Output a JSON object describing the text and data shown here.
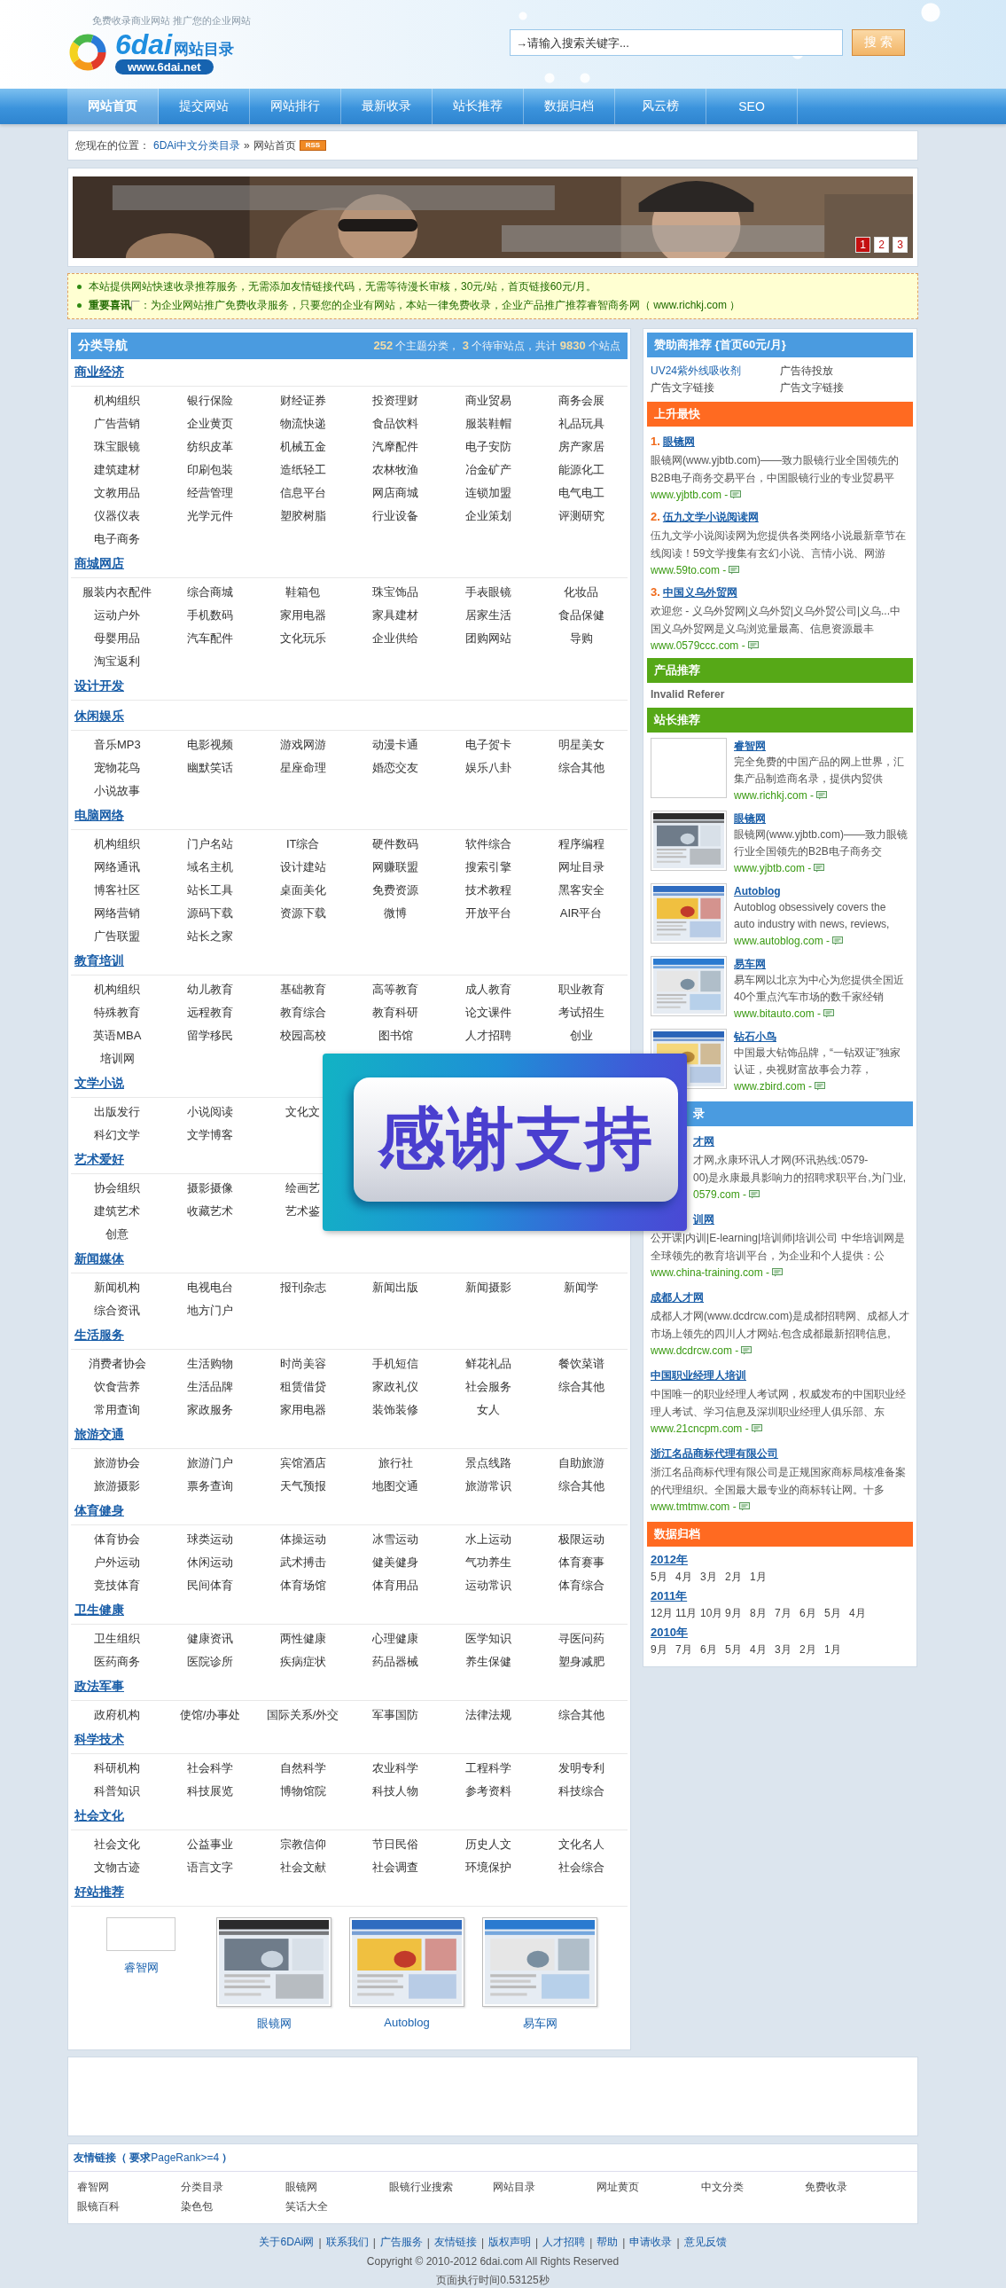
{
  "header": {
    "tagline": "免费收录商业网站 推广您的企业网站",
    "logo_mark": "6dai",
    "logo_title": "网站目录",
    "logo_url": "www.6dai.net",
    "search": {
      "placeholder": "→请输入搜索关键字..."
    },
    "search_button": "搜 索"
  },
  "nav": [
    {
      "label": "网站首页",
      "selected": true
    },
    {
      "label": "提交网站",
      "selected": false
    },
    {
      "label": "网站排行",
      "selected": false
    },
    {
      "label": "最新收录",
      "selected": false
    },
    {
      "label": "站长推荐",
      "selected": false
    },
    {
      "label": "数据归档",
      "selected": false
    },
    {
      "label": "风云榜",
      "selected": false
    },
    {
      "label": "SEO",
      "selected": false
    }
  ],
  "breadcrumb": {
    "prefix": "您现在的位置：",
    "link": "6DAi中文分类目录",
    "separator": "»",
    "current": "网站首页",
    "badge": "RSS"
  },
  "banner": {
    "kind": "picture",
    "pages": [
      {
        "label": "1",
        "selected": true
      },
      {
        "label": "2",
        "selected": false
      },
      {
        "label": "3",
        "selected": false
      }
    ]
  },
  "notices": [
    {
      "kind": "plain",
      "text": "本站提供网站快速收录推荐服务，无需添加友情链接代码，无需等待漫长审核，30元/站，首页链接60元/月。"
    },
    {
      "kind": "announcement",
      "lead": "重要喜讯",
      "text": "：为企业网站推广免费收录服务，只要您的企业有网站，本站一律免费收录，企业产品推广推荐睿智商务网（ www.richkj.com ）"
    }
  ],
  "directory": {
    "title": "分类导航",
    "stats": "**252** 个主题分类， **3** 个待审站点，共计 **9830** 个站点",
    "categories": [
      {
        "name": "商业经济",
        "rows": [
          [
            "机构组织",
            "银行保险",
            "财经证券",
            "投资理财",
            "商业贸易",
            "商务会展"
          ],
          [
            "广告营销",
            "企业黄页",
            "物流快递",
            "食品饮料",
            "服装鞋帽",
            "礼品玩具"
          ],
          [
            "珠宝眼镜",
            "纺织皮革",
            "机械五金",
            "汽摩配件",
            "电子安防",
            "房产家居"
          ],
          [
            "建筑建材",
            "印刷包装",
            "造纸轻工",
            "农林牧渔",
            "冶金矿产",
            "能源化工"
          ],
          [
            "文教用品",
            "经营管理",
            "信息平台",
            "网店商城",
            "连锁加盟",
            "电气电工"
          ],
          [
            "仪器仪表",
            "光学元件",
            "塑胶树脂",
            "行业设备",
            "企业策划",
            "评测研究"
          ],
          [
            "电子商务"
          ]
        ]
      },
      {
        "name": "商城网店",
        "rows": [
          [
            "服装内衣配件",
            "综合商城",
            "鞋箱包",
            "珠宝饰品",
            "手表眼镜",
            "化妆品"
          ],
          [
            "运动户外",
            "手机数码",
            "家用电器",
            "家具建材",
            "居家生活",
            "食品保健"
          ],
          [
            "母婴用品",
            "汽车配件",
            "文化玩乐",
            "企业供给",
            "团购网站",
            "导购"
          ],
          [
            "淘宝返利"
          ]
        ]
      },
      {
        "name": "设计开发"
      },
      {
        "name": "休闲娱乐",
        "rows": [
          [
            "音乐MP3",
            "电影视频",
            "游戏网游",
            "动漫卡通",
            "电子贺卡",
            "明星美女"
          ],
          [
            "宠物花鸟",
            "幽默笑话",
            "星座命理",
            "婚恋交友",
            "娱乐八卦",
            "综合其他"
          ],
          [
            "小说故事"
          ]
        ]
      },
      {
        "name": "电脑网络",
        "rows": [
          [
            "机构组织",
            "门户名站",
            "IT综合",
            "硬件数码",
            "软件综合",
            "程序编程"
          ],
          [
            "网络通讯",
            "域名主机",
            "设计建站",
            "网赚联盟",
            "搜索引擎",
            "网址目录"
          ],
          [
            "博客社区",
            "站长工具",
            "桌面美化",
            "免费资源",
            "技术教程",
            "黑客安全"
          ],
          [
            "网络营销",
            "源码下载",
            "资源下载",
            "微博",
            "开放平台",
            "AIR平台"
          ],
          [
            "广告联盟",
            "站长之家"
          ]
        ]
      },
      {
        "name": "教育培训",
        "rows": [
          [
            "机构组织",
            "幼儿教育",
            "基础教育",
            "高等教育",
            "成人教育",
            "职业教育"
          ],
          [
            "特殊教育",
            "远程教育",
            "教育综合",
            "教育科研",
            "论文课件",
            "考试招生"
          ],
          [
            "英语MBA",
            "留学移民",
            "校园高校",
            "图书馆",
            "人才招聘",
            "创业"
          ],
          [
            "培训网"
          ]
        ]
      },
      {
        "name": "文学小说",
        "rows": [
          [
            "出版发行",
            "小说阅读",
            "文化文"
          ],
          [
            "科幻文学",
            "文学博客"
          ]
        ]
      },
      {
        "name": "艺术爱好",
        "rows": [
          [
            "协会组织",
            "摄影摄像",
            "绘画艺"
          ],
          [
            "建筑艺术",
            "收藏艺术",
            "艺术鉴"
          ],
          [
            "创意"
          ]
        ]
      },
      {
        "name": "新闻媒体",
        "rows": [
          [
            "新闻机构",
            "电视电台",
            "报刊杂志",
            "新闻出版",
            "新闻摄影",
            "新闻学"
          ],
          [
            "综合资讯",
            "地方门户"
          ]
        ]
      },
      {
        "name": "生活服务",
        "rows": [
          [
            "消费者协会",
            "生活购物",
            "时尚美容",
            "手机短信",
            "鲜花礼品",
            "餐饮菜谱"
          ],
          [
            "饮食营养",
            "生活品牌",
            "租赁借贷",
            "家政礼仪",
            "社会服务",
            "综合其他"
          ],
          [
            "常用查询",
            "家政服务",
            "家用电器",
            "装饰装修",
            "女人"
          ]
        ]
      },
      {
        "name": "旅游交通",
        "rows": [
          [
            "旅游协会",
            "旅游门户",
            "宾馆酒店",
            "旅行社",
            "景点线路",
            "自助旅游"
          ],
          [
            "旅游摄影",
            "票务查询",
            "天气预报",
            "地图交通",
            "旅游常识",
            "综合其他"
          ]
        ]
      },
      {
        "name": "体育健身",
        "rows": [
          [
            "体育协会",
            "球类运动",
            "体操运动",
            "冰雪运动",
            "水上运动",
            "极限运动"
          ],
          [
            "户外运动",
            "休闲运动",
            "武术搏击",
            "健美健身",
            "气功养生",
            "体育赛事"
          ],
          [
            "竞技体育",
            "民间体育",
            "体育场馆",
            "体育用品",
            "运动常识",
            "体育综合"
          ]
        ]
      },
      {
        "name": "卫生健康",
        "rows": [
          [
            "卫生组织",
            "健康资讯",
            "两性健康",
            "心理健康",
            "医学知识",
            "寻医问药"
          ],
          [
            "医药商务",
            "医院诊所",
            "疾病症状",
            "药品器械",
            "养生保健",
            "塑身减肥"
          ]
        ]
      },
      {
        "name": "政法军事",
        "rows": [
          [
            "政府机构",
            "使馆/办事处",
            "国际关系/外交",
            "军事国防",
            "法律法规",
            "综合其他"
          ]
        ]
      },
      {
        "name": "科学技术",
        "rows": [
          [
            "科研机构",
            "社会科学",
            "自然科学",
            "农业科学",
            "工程科学",
            "发明专利"
          ],
          [
            "科普知识",
            "科技展览",
            "博物馆院",
            "科技人物",
            "参考资料",
            "科技综合"
          ]
        ]
      },
      {
        "name": "社会文化",
        "rows": [
          [
            "社会文化",
            "公益事业",
            "宗教信仰",
            "节日民俗",
            "历史人文",
            "文化名人"
          ],
          [
            "文物古迹",
            "语言文字",
            "社会文献",
            "社会调查",
            "环境保护",
            "社会综合"
          ]
        ]
      }
    ],
    "featured": {
      "title": "好站推荐",
      "sites": [
        {
          "name": "睿智网",
          "kind": "empty"
        },
        {
          "name": "眼镜网",
          "kind": "picture"
        },
        {
          "name": "Autoblog",
          "kind": "picture"
        },
        {
          "name": "易车网",
          "kind": "picture"
        }
      ]
    }
  },
  "popup": {
    "text": "感谢支持"
  },
  "sidebar": [
    {
      "kind": "sponsors",
      "title": "赞助商推荐 {首页60元/月}",
      "color": "#4a9be0",
      "covered": false,
      "links": [
        {
          "text": "UV24紫外线吸收剂",
          "kind": "link"
        },
        {
          "text": "广告待投放",
          "kind": "text"
        },
        {
          "text": "广告文字链接",
          "kind": "text"
        },
        {
          "text": "广告文字链接",
          "kind": "text"
        }
      ]
    },
    {
      "kind": "ranked",
      "title": "上升最快",
      "color": "#ff6a21",
      "covered": false,
      "entries": [
        {
          "rank": "1.",
          "title": "眼镜网",
          "desc": "眼镜网(www.yjbtb.com)——致力眼镜行业全国领先的B2B电子商务交易平台，中国眼镜行业的专业贸易平",
          "url": "www.yjbtb.com -"
        },
        {
          "rank": "2.",
          "title": "伍九文学小说阅读网",
          "desc": "伍九文学小说阅读网为您提供各类网络小说最新章节在线阅读！59文学搜集有玄幻小说、言情小说、网游",
          "url": "www.59to.com -"
        },
        {
          "rank": "3.",
          "title": "中国义乌外贸网",
          "desc": "欢迎您 - 义乌外贸网|义乌外贸|义乌外贸公司|义乌...中国义乌外贸网是义乌浏览量最高、信息资源最丰",
          "url": "www.0579ccc.com -"
        }
      ]
    },
    {
      "kind": "note",
      "title": "产品推荐",
      "color": "#56a817",
      "covered": false,
      "text": "Invalid Referer"
    },
    {
      "kind": "thumbs",
      "title": "站长推荐",
      "color": "#56a817",
      "covered": false,
      "entries": [
        {
          "title": "睿智网",
          "kind": "empty",
          "desc": "完全免费的中国产品的网上世界，汇集产品制造商名录，提供内贸供",
          "url": "www.richkj.com -"
        },
        {
          "title": "眼镜网",
          "kind": "picture",
          "desc": "眼镜网(www.yjbtb.com)——致力眼镜行业全国领先的B2B电子商务交",
          "url": "www.yjbtb.com -"
        },
        {
          "title": "Autoblog",
          "kind": "picture",
          "desc": "Autoblog obsessively covers the auto industry with news, reviews,",
          "url": "www.autoblog.com -"
        },
        {
          "title": "易车网",
          "kind": "picture",
          "desc": "易车网以北京为中心为您提供全国近40个重点汽车市场的数千家经销",
          "url": "www.bitauto.com -"
        },
        {
          "title": "钻石小鸟",
          "kind": "picture",
          "desc": "中国最大钻饰品牌，“一钻双证”独家认证，央视财富故事会力荐，",
          "url": "www.zbird.com -"
        }
      ]
    },
    {
      "kind": "list",
      "title": "录",
      "color": "#4a9be0",
      "covered": true,
      "entries": [
        {
          "title": "才网",
          "kind": "covered",
          "lines": [
            "才网,永康环讯人才网(环讯热线:0579-",
            "00)是永康最具影响力的招聘求职平台,为门业,"
          ],
          "url": "0579.com -"
        },
        {
          "title": "训网",
          "kind": "covered",
          "desc": "公开课|内训|E-learning|培训师|培训公司  中华培训网是全球领先的教育培训平台，为企业和个人提供：公",
          "url": "www.china-training.com -"
        },
        {
          "title": "成都人才网",
          "kind": "plain",
          "desc": "成都人才网(www.dcdrcw.com)是成都招聘网、成都人才市场上领先的四川人才网站.包含成都最新招聘信息,",
          "url": "www.dcdrcw.com -"
        },
        {
          "title": "中国职业经理人培训",
          "kind": "plain",
          "desc": "中国唯一的职业经理人考试网，权威发布的中国职业经理人考试、学习信息及深圳职业经理人俱乐部、东",
          "url": "www.21cncpm.com -"
        },
        {
          "title": "浙江名品商标代理有限公司",
          "kind": "plain",
          "desc": "浙江名品商标代理有限公司是正规国家商标局核准备案的代理组织。全国最大最专业的商标转让网。十多",
          "url": "www.tmtmw.com -"
        }
      ]
    },
    {
      "kind": "archive",
      "title": "数据归档",
      "color": "#ff6a21",
      "covered": false,
      "years": [
        {
          "label": "2012年",
          "months": [
            "5月",
            "4月",
            "3月",
            "2月",
            "1月"
          ]
        },
        {
          "label": "2011年",
          "months": [
            "12月",
            "11月",
            "10月",
            "9月",
            "8月",
            "7月",
            "6月",
            "5月",
            "4月"
          ]
        },
        {
          "label": "2010年",
          "months": [
            "9月",
            "7月",
            "6月",
            "5月",
            "4月",
            "3月",
            "2月",
            "1月"
          ]
        }
      ]
    }
  ],
  "friend_links": {
    "title": "**友情链接（ 要求**PageRank>=4 **）**",
    "links": [
      "睿智网",
      "分类目录",
      "眼镜网",
      "眼镜行业搜索",
      "网站目录",
      "网址黄页",
      "中文分类",
      "免费收录",
      "眼镜百科",
      "染色包",
      "笑话大全"
    ]
  },
  "footer": {
    "separator": "|",
    "links": [
      "关于6DAi网",
      "联系我们",
      "广告服务",
      "友情链接",
      "版权声明",
      "人才招聘",
      "帮助",
      "申请收录",
      "意见反馈"
    ],
    "copyright": "Copyright © 2010-2012 6dai.com All Rights Reserved",
    "timing": "页面执行时间0.53125秒"
  }
}
